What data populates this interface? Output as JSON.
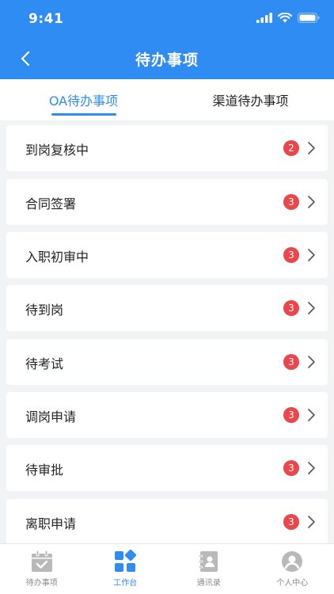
{
  "status_bar": {
    "time": "9:41"
  },
  "nav": {
    "title": "待办事项"
  },
  "tabs": [
    {
      "label": "OA待办事项",
      "active": true
    },
    {
      "label": "渠道待办事项",
      "active": false
    }
  ],
  "items": [
    {
      "label": "到岗复核中",
      "count": "2"
    },
    {
      "label": "合同签署",
      "count": "3"
    },
    {
      "label": "入职初审中",
      "count": "3"
    },
    {
      "label": "待到岗",
      "count": "3"
    },
    {
      "label": "待考试",
      "count": "3"
    },
    {
      "label": "调岗申请",
      "count": "3"
    },
    {
      "label": "待审批",
      "count": "3"
    },
    {
      "label": "离职申请",
      "count": "3"
    }
  ],
  "tabbar": [
    {
      "label": "待办事项",
      "icon": "calendar-check-icon",
      "active": false
    },
    {
      "label": "工作台",
      "icon": "workbench-grid-icon",
      "active": true
    },
    {
      "label": "通讯录",
      "icon": "contacts-book-icon",
      "active": false
    },
    {
      "label": "个人中心",
      "icon": "user-avatar-icon",
      "active": false
    }
  ],
  "colors": {
    "primary": "#2f8cf2",
    "badge": "#e9474b",
    "background": "#f2f3f5",
    "inactive_icon": "#b9b9b9"
  }
}
